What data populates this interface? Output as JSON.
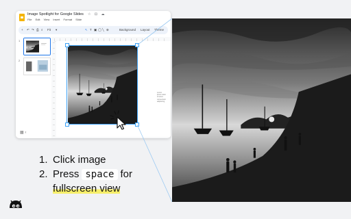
{
  "window": {
    "doc_title": "Image Spotlight for Google Slides",
    "title_icons": "☆ ⊡ ☁",
    "menu": [
      "File",
      "Edit",
      "View",
      "Insert",
      "Format",
      "Slide"
    ],
    "toolbar": {
      "zoom": "Fit",
      "background": "Background",
      "layout": "Layout",
      "theme": "Theme"
    },
    "slides": [
      {
        "number": "1"
      },
      {
        "number": "2"
      }
    ],
    "slide_text": "Lorem\nipsum dolor\nsit amet\nconsectetur\nadipiscing"
  },
  "instructions": {
    "step1_num": "1.",
    "step1_text": "Click image",
    "step2_num": "2.",
    "step2_pre": "Press",
    "step2_key": "space",
    "step2_post": "for",
    "step2_line2": "fullscreen view"
  },
  "colors": {
    "selection": "#3aa0f5",
    "highlight": "#f7ef6a",
    "slides_logo": "#f4b400"
  }
}
